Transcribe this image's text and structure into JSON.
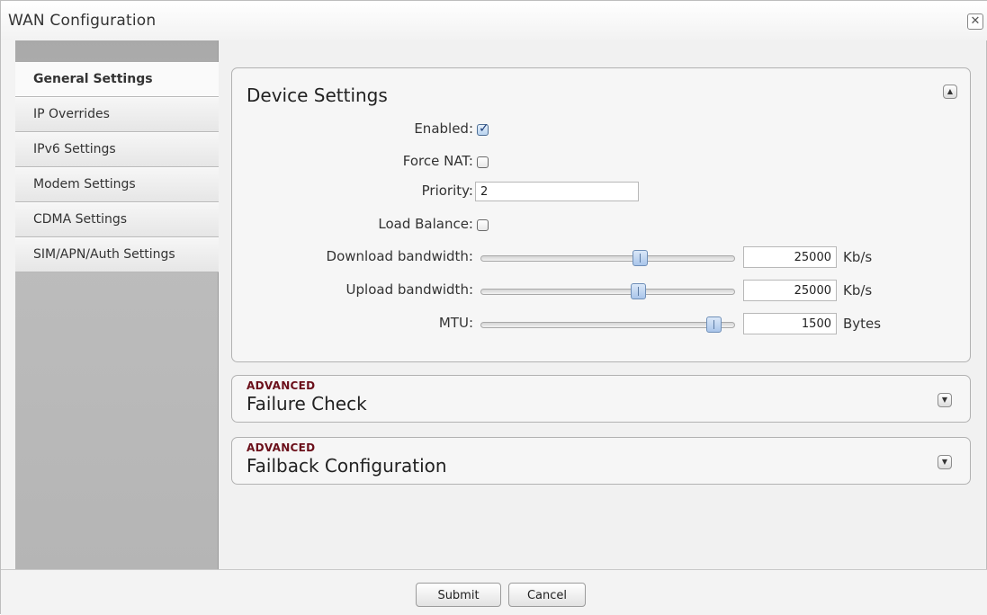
{
  "window": {
    "title": "WAN Configuration",
    "close_glyph": "✕"
  },
  "sidebar": {
    "items": [
      {
        "label": "General Settings",
        "active": true
      },
      {
        "label": "IP Overrides"
      },
      {
        "label": "IPv6 Settings"
      },
      {
        "label": "Modem Settings"
      },
      {
        "label": "CDMA Settings"
      },
      {
        "label": "SIM/APN/Auth Settings"
      }
    ]
  },
  "device_settings": {
    "title": "Device Settings",
    "collapse_icon": "▲",
    "enabled": {
      "label": "Enabled:",
      "checked": true
    },
    "force_nat": {
      "label": "Force NAT:",
      "checked": false
    },
    "priority": {
      "label": "Priority:",
      "value": "2"
    },
    "load_balance": {
      "label": "Load Balance:",
      "checked": false
    },
    "download": {
      "label": "Download bandwidth:",
      "value": "25000",
      "unit": "Kb/s"
    },
    "upload": {
      "label": "Upload bandwidth:",
      "value": "25000",
      "unit": "Kb/s"
    },
    "mtu": {
      "label": "MTU:",
      "value": "1500",
      "unit": "Bytes"
    }
  },
  "failure_check": {
    "badge": "ADVANCED",
    "title": "Failure Check",
    "expand_icon": "▼"
  },
  "failback": {
    "badge": "ADVANCED",
    "title": "Failback Configuration",
    "expand_icon": "▼"
  },
  "footer": {
    "submit_label": "Submit",
    "cancel_label": "Cancel"
  }
}
